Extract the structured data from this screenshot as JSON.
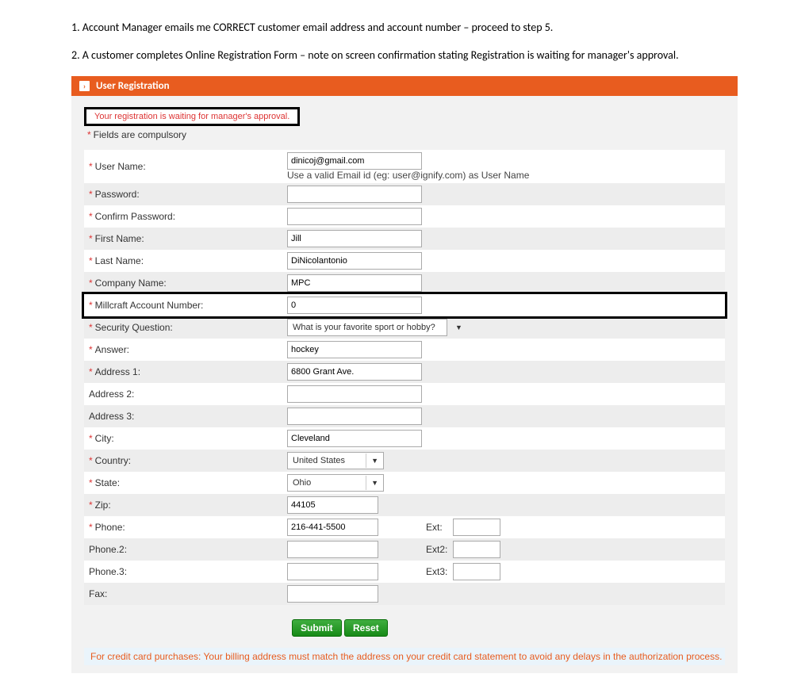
{
  "instructions": {
    "step1": "1. Account Manager emails me CORRECT customer email address and account number – proceed to step 5.",
    "step2": "2. A customer completes Online Registration  Form – note on screen confirmation stating Registration is waiting for manager's approval."
  },
  "panel_title": "User Registration",
  "notice": "Your registration is waiting for manager's approval.",
  "compulsory": "Fields are compulsory",
  "labels": {
    "username": "User Name:",
    "username_helper": "Use a valid Email id (eg: user@ignify.com) as User Name",
    "password": "Password:",
    "confirm_password": "Confirm Password:",
    "first_name": "First Name:",
    "last_name": "Last Name:",
    "company_name": "Company Name:",
    "account_number": "Millcraft Account Number:",
    "security_question": "Security Question:",
    "answer": "Answer:",
    "address1": "Address 1:",
    "address2": "Address 2:",
    "address3": "Address 3:",
    "city": "City:",
    "country": "Country:",
    "state": "State:",
    "zip": "Zip:",
    "phone": "Phone:",
    "phone2": "Phone.2:",
    "phone3": "Phone.3:",
    "fax": "Fax:",
    "ext": "Ext:",
    "ext2": "Ext2:",
    "ext3": "Ext3:"
  },
  "values": {
    "username": "dinicoj@gmail.com",
    "password": "",
    "confirm_password": "",
    "first_name": "Jill",
    "last_name": "DiNicolantonio",
    "company_name": "MPC",
    "account_number": "0",
    "security_question": "What is your favorite sport or hobby?",
    "answer": "hockey",
    "address1": "6800 Grant Ave.",
    "address2": "",
    "address3": "",
    "city": "Cleveland",
    "country": "United States",
    "state": "Ohio",
    "zip": "44105",
    "phone": "216-441-5500",
    "phone2": "",
    "phone3": "",
    "fax": "",
    "ext": "",
    "ext2": "",
    "ext3": ""
  },
  "buttons": {
    "submit": "Submit",
    "reset": "Reset"
  },
  "footnote": "For credit card purchases: Your billing address must match the address on your credit card statement to avoid any delays in the authorization process."
}
